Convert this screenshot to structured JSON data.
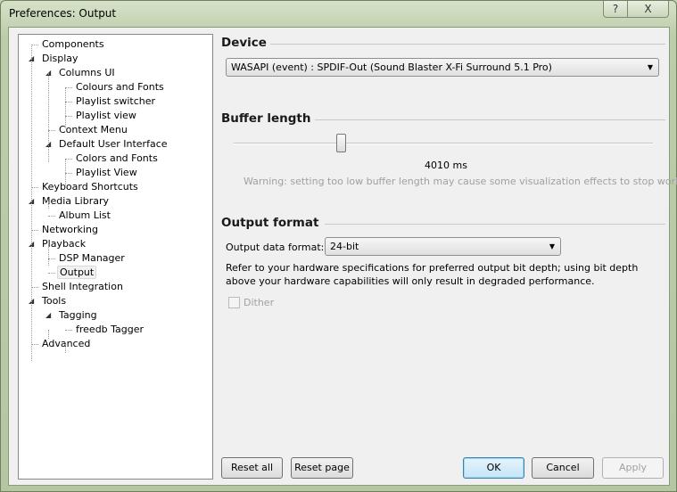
{
  "window": {
    "title": "Preferences: Output",
    "help_label": "?",
    "close_label": "X"
  },
  "tree": [
    {
      "label": "Components",
      "level": 0,
      "expander": false
    },
    {
      "label": "Display",
      "level": 0,
      "expander": true
    },
    {
      "label": "Columns UI",
      "level": 1,
      "expander": true
    },
    {
      "label": "Colours and Fonts",
      "level": 2,
      "expander": false
    },
    {
      "label": "Playlist switcher",
      "level": 2,
      "expander": false
    },
    {
      "label": "Playlist view",
      "level": 2,
      "expander": false
    },
    {
      "label": "Context Menu",
      "level": 1,
      "expander": false
    },
    {
      "label": "Default User Interface",
      "level": 1,
      "expander": true
    },
    {
      "label": "Colors and Fonts",
      "level": 2,
      "expander": false
    },
    {
      "label": "Playlist View",
      "level": 2,
      "expander": false
    },
    {
      "label": "Keyboard Shortcuts",
      "level": 0,
      "expander": false
    },
    {
      "label": "Media Library",
      "level": 0,
      "expander": true
    },
    {
      "label": "Album List",
      "level": 1,
      "expander": false
    },
    {
      "label": "Networking",
      "level": 0,
      "expander": false
    },
    {
      "label": "Playback",
      "level": 0,
      "expander": true
    },
    {
      "label": "DSP Manager",
      "level": 1,
      "expander": false
    },
    {
      "label": "Output",
      "level": 1,
      "expander": false,
      "selected": true
    },
    {
      "label": "Shell Integration",
      "level": 0,
      "expander": false
    },
    {
      "label": "Tools",
      "level": 0,
      "expander": true
    },
    {
      "label": "Tagging",
      "level": 1,
      "expander": true
    },
    {
      "label": "freedb Tagger",
      "level": 2,
      "expander": false
    },
    {
      "label": "Advanced",
      "level": 0,
      "expander": false
    }
  ],
  "device": {
    "heading": "Device",
    "selected": "WASAPI (event) : SPDIF-Out (Sound Blaster X-Fi Surround 5.1 Pro)"
  },
  "buffer": {
    "heading": "Buffer length",
    "value_label": "4010 ms",
    "slider_fraction": 0.255,
    "warning": "Warning: setting too low buffer length may cause some visualization effects to stop working."
  },
  "output_format": {
    "heading": "Output format",
    "label": "Output data format:",
    "selected": "24-bit",
    "note": "Refer to your hardware specifications for preferred output bit depth; using bit depth above your hardware capabilities will only result in degraded performance.",
    "dither_label": "Dither",
    "dither_checked": false,
    "dither_enabled": false
  },
  "buttons": {
    "reset_all": "Reset all",
    "reset_page": "Reset page",
    "ok": "OK",
    "cancel": "Cancel",
    "apply": "Apply"
  }
}
